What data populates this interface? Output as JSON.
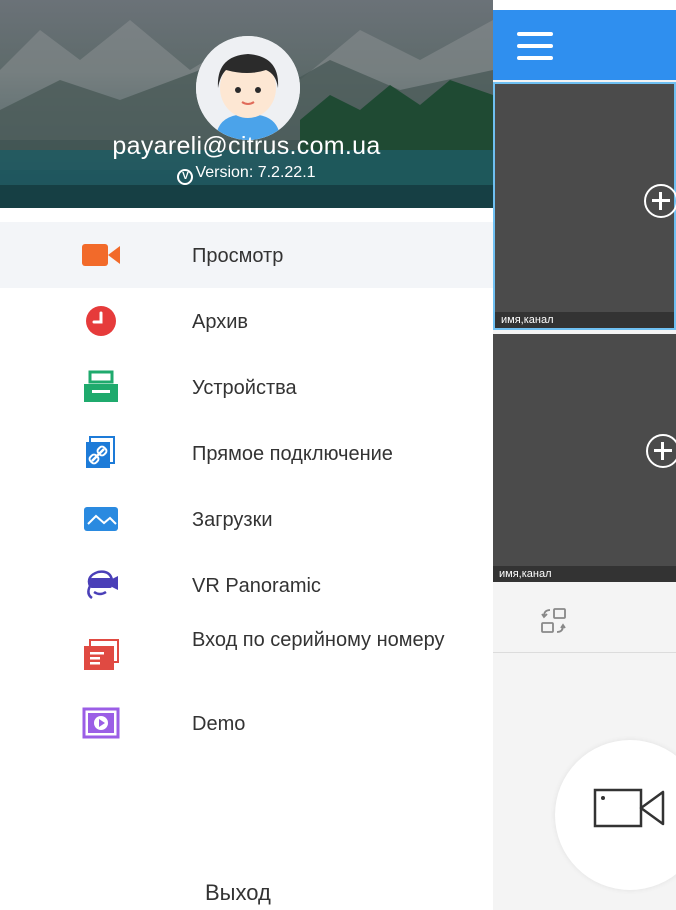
{
  "header": {
    "email": "payareli@citrus.com.ua",
    "version": "Version: 7.2.22.1"
  },
  "menu": {
    "items": [
      {
        "label": "Просмотр",
        "icon": "camera-icon",
        "active": true
      },
      {
        "label": "Архив",
        "icon": "clock-icon"
      },
      {
        "label": "Устройства",
        "icon": "device-icon"
      },
      {
        "label": "Прямое подключение",
        "icon": "link-icon"
      },
      {
        "label": "Загрузки",
        "icon": "image-icon"
      },
      {
        "label": "VR Panoramic",
        "icon": "vr-headset-icon"
      },
      {
        "label": "Вход по серийному номеру",
        "icon": "serial-card-icon"
      },
      {
        "label": "Demo",
        "icon": "play-icon"
      }
    ],
    "logout_label": "Выход"
  },
  "preview": {
    "tiles": [
      {
        "label": "имя,канал"
      },
      {
        "label": "имя,канал"
      }
    ]
  },
  "colors": {
    "topbar": "#2f8fef",
    "tile": "#4b4b4b",
    "active_border": "#6fc0f2"
  }
}
